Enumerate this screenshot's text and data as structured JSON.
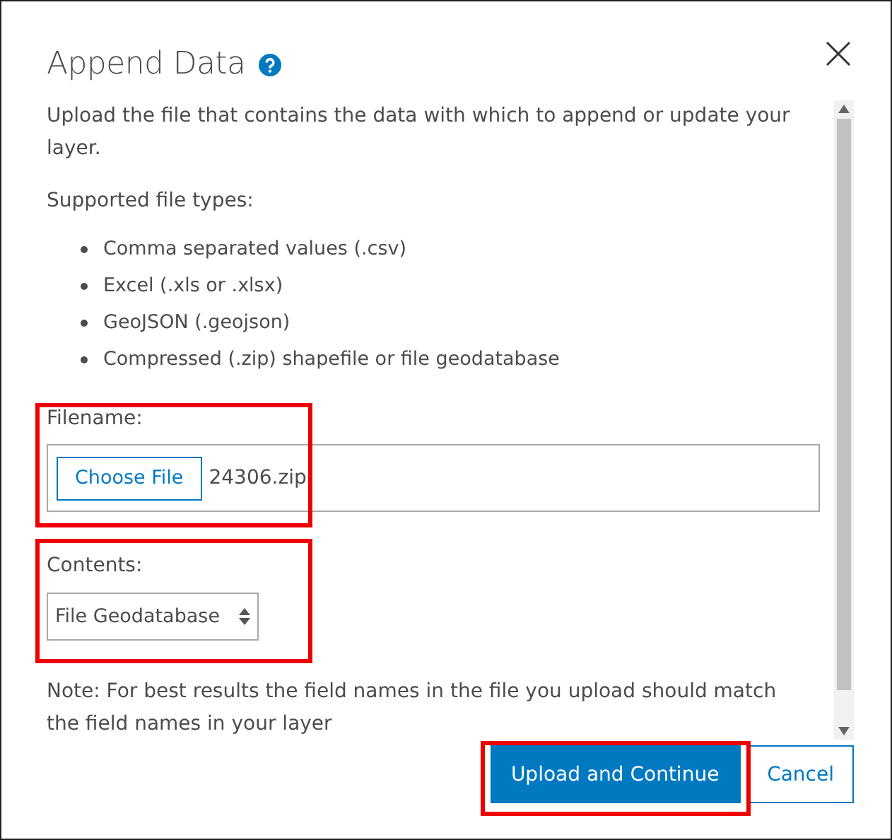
{
  "dialog": {
    "title": "Append Data"
  },
  "intro": "Upload the file that contains the data with which to append or update your layer.",
  "types_heading": "Supported file types:",
  "file_types": [
    "Comma separated values (.csv)",
    "Excel (.xls or .xlsx)",
    "GeoJSON (.geojson)",
    "Compressed (.zip) shapefile or file geodatabase"
  ],
  "filename": {
    "label": "Filename:",
    "button": "Choose File",
    "value": "24306.zip"
  },
  "contents": {
    "label": "Contents:",
    "value": "File Geodatabase"
  },
  "note": "Note: For best results the field names in the file you upload should match the field names in your layer",
  "buttons": [
    {
      "label": "Upload and Continue",
      "kind": "primary"
    },
    {
      "label": "Cancel",
      "kind": "secondary"
    }
  ]
}
